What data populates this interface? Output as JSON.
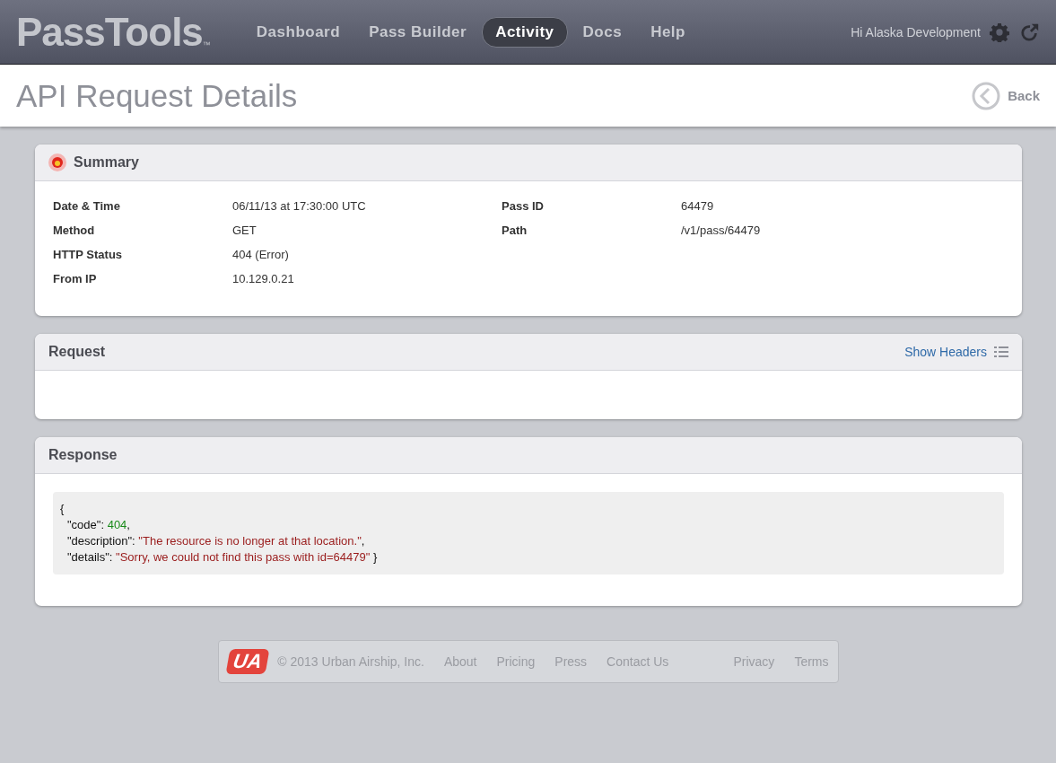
{
  "header": {
    "logo": "PassTools",
    "logo_mark": "™",
    "nav": [
      {
        "label": "Dashboard",
        "selected": false
      },
      {
        "label": "Pass Builder",
        "selected": false
      },
      {
        "label": "Activity",
        "selected": true
      },
      {
        "label": "Docs",
        "selected": false
      },
      {
        "label": "Help",
        "selected": false
      }
    ],
    "greeting": "Hi Alaska Development"
  },
  "page": {
    "title": "API Request Details",
    "back": "Back"
  },
  "summary": {
    "title": "Summary",
    "columns": [
      [
        {
          "label": "Date & Time",
          "value": "06/11/13 at 17:30:00 UTC"
        },
        {
          "label": "Method",
          "value": "GET"
        },
        {
          "label": "HTTP Status",
          "value": "404 (Error)"
        },
        {
          "label": "From IP",
          "value": "10.129.0.21"
        }
      ],
      [
        {
          "label": "Pass ID",
          "value": "64479"
        },
        {
          "label": "Path",
          "value": "/v1/pass/64479"
        }
      ]
    ]
  },
  "request": {
    "title": "Request",
    "action": "Show Headers"
  },
  "response": {
    "title": "Response",
    "lines": [
      [
        {
          "kind": "punct",
          "text": "{"
        }
      ],
      [
        {
          "kind": "key",
          "text": "\"code\""
        },
        {
          "kind": "punct",
          "text": ": "
        },
        {
          "kind": "number",
          "text": "404"
        },
        {
          "kind": "punct",
          "text": ","
        }
      ],
      [
        {
          "kind": "key",
          "text": "\"description\""
        },
        {
          "kind": "punct",
          "text": ": "
        },
        {
          "kind": "string",
          "text": "\"The resource is no longer at that location.\""
        },
        {
          "kind": "punct",
          "text": ","
        }
      ],
      [
        {
          "kind": "key",
          "text": "\"details\""
        },
        {
          "kind": "punct",
          "text": ": "
        },
        {
          "kind": "string",
          "text": "\"Sorry, we could not find this pass with id=64479\""
        },
        {
          "kind": "punct",
          "text": " }"
        }
      ]
    ]
  },
  "footer": {
    "logo": "UA",
    "copyright": "© 2013 Urban Airship, Inc.",
    "links": [
      "About",
      "Pricing",
      "Press",
      "Contact Us"
    ],
    "legal": [
      "Privacy",
      "Terms"
    ]
  }
}
